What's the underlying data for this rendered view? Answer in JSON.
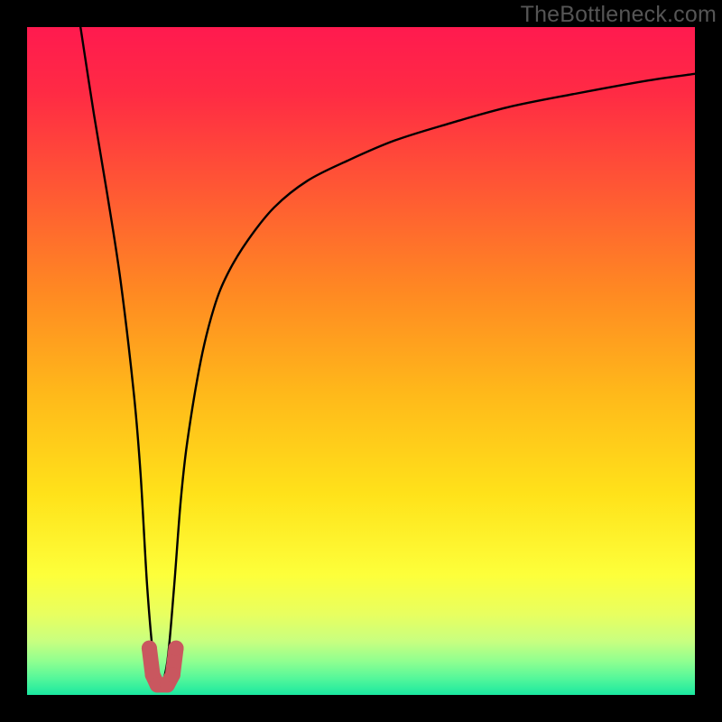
{
  "watermark": "TheBottleneck.com",
  "colors": {
    "black": "#000000",
    "curve": "#000000",
    "marker": "#c9575f",
    "gradient_stops": [
      {
        "pos": 0.0,
        "color": "#ff1a4f"
      },
      {
        "pos": 0.1,
        "color": "#ff2b44"
      },
      {
        "pos": 0.25,
        "color": "#ff5a33"
      },
      {
        "pos": 0.4,
        "color": "#ff8a22"
      },
      {
        "pos": 0.55,
        "color": "#ffb91a"
      },
      {
        "pos": 0.7,
        "color": "#ffe21a"
      },
      {
        "pos": 0.82,
        "color": "#fdff3a"
      },
      {
        "pos": 0.88,
        "color": "#e8ff60"
      },
      {
        "pos": 0.92,
        "color": "#c8ff80"
      },
      {
        "pos": 0.95,
        "color": "#8fff90"
      },
      {
        "pos": 0.975,
        "color": "#55f79a"
      },
      {
        "pos": 1.0,
        "color": "#1ae8a0"
      }
    ]
  },
  "chart_data": {
    "type": "line",
    "title": "",
    "xlabel": "",
    "ylabel": "",
    "xlim": [
      0,
      100
    ],
    "ylim": [
      0,
      100
    ],
    "notch_x": 20,
    "notch_width": 4,
    "series": [
      {
        "name": "curve",
        "x": [
          8,
          10,
          12,
          14,
          16,
          17,
          18,
          19,
          20,
          21,
          22,
          23,
          24,
          26,
          28,
          30,
          33,
          37,
          42,
          48,
          55,
          63,
          72,
          82,
          93,
          100
        ],
        "y": [
          100,
          87,
          75,
          62,
          45,
          33,
          16,
          5,
          2,
          5,
          16,
          29,
          38,
          50,
          58,
          63,
          68,
          73,
          77,
          80,
          83,
          85.5,
          88,
          90,
          92,
          93
        ]
      }
    ],
    "markers": [
      {
        "name": "left-marker",
        "x": 18.3,
        "y": 7
      },
      {
        "name": "left-marker-low",
        "x": 18.8,
        "y": 3
      },
      {
        "name": "bottom-left",
        "x": 19.5,
        "y": 1.5
      },
      {
        "name": "bottom-right",
        "x": 21.0,
        "y": 1.5
      },
      {
        "name": "right-marker-low",
        "x": 21.8,
        "y": 3
      },
      {
        "name": "right-marker",
        "x": 22.3,
        "y": 7
      }
    ]
  }
}
